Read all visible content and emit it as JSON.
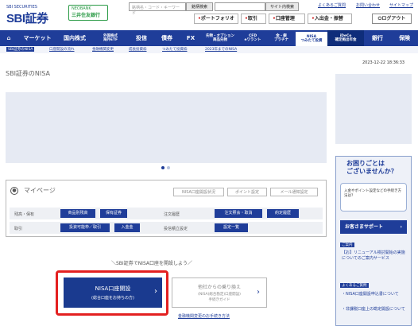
{
  "header": {
    "logo_brand": "SBI証券",
    "logo_sub": "SBI SECURITIES",
    "bank_line1": "NEOBANK",
    "bank_line2": "三井住友銀行",
    "search_placeholder": "銘柄名・コード・キーワード",
    "search_button": "銘柄検索",
    "site_search_button": "サイト内検索",
    "links": [
      "よくあるご質問",
      "お問い合わせ",
      "サイトマップ"
    ],
    "portfolio": "ポートフォリオ",
    "trade": "取引",
    "account": "口座管理",
    "deposit": "入出金・振替",
    "logout": "ログアウト"
  },
  "nav": {
    "home_icon": "home-icon",
    "items": [
      {
        "label": "マーケット"
      },
      {
        "label": "国内株式"
      },
      {
        "label": "外国株式\n海外ETF"
      },
      {
        "label": "投信"
      },
      {
        "label": "債券"
      },
      {
        "label": "FX"
      },
      {
        "label": "先物・オプション\n商品先物"
      },
      {
        "label": "CFD\neワラント"
      },
      {
        "label": "金・銀\nプラチナ"
      },
      {
        "label": "NISA\nつみたて投資"
      },
      {
        "label": "iDeCo\n確定拠出年金"
      },
      {
        "label": "銀行"
      },
      {
        "label": "保険"
      }
    ]
  },
  "subnav": {
    "items": [
      "SBI証券のNISA",
      "口座開設の流れ",
      "金融機関変更",
      "成長投資枠",
      "つみたて投資枠",
      "2023年までのNISA"
    ]
  },
  "datetime": "2023-12-22 18:36:33",
  "page_title": "SBI証券のNISA",
  "mypage": {
    "title": "マイページ",
    "top_buttons": [
      "NISA口座開設状況",
      "ポイント設定",
      "メール通知設定"
    ],
    "row1": {
      "label1": "残高・保有",
      "btn1": "商品別残高",
      "btn2": "保有証券",
      "label2": "注文履歴",
      "btn3": "注文照会・取消",
      "btn4": "約定履歴"
    },
    "row2": {
      "label1": "取引",
      "btn1": "投資可能枠／取引",
      "btn2": "入金金",
      "label2": "投信積立設定",
      "btn3": "設定一覧"
    }
  },
  "cta": {
    "suggest": "＼SBI証券でNISA口座を開設しよう／",
    "open_line1": "NISA口座開設",
    "open_line2": "(総合口座をお持ちの方)",
    "move_line1": "他社からの乗り換え",
    "move_line2": "(NISA(総合勘定)口座開設)",
    "move_line3": "手続きガイド",
    "move_link": "金融機関変更のお手続き方法"
  },
  "help": {
    "title": "お困りごとは\nございませんか？",
    "question": "入金やポイント設定などの手続き方法は？",
    "support_btn": "お客さまサポート",
    "label1": "ご案内",
    "item1": "【お】リニューアル検討開始の実施についてのご案内サービス",
    "label2": "よくあるご質問",
    "item2": "・NISA口座開設申込書について",
    "item3": "・非課税口座上の勘定開設について"
  }
}
